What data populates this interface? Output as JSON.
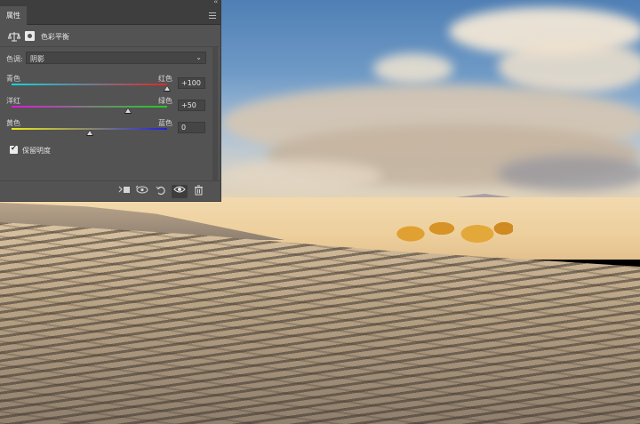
{
  "panel": {
    "tab_label": "属性",
    "collapse_glyph": "‹‹",
    "header_title": "色彩平衡",
    "tone": {
      "label": "色调:",
      "selected": "阴影"
    },
    "sliders": [
      {
        "left_label": "青色",
        "right_label": "红色",
        "value": "+100",
        "level": 1.0
      },
      {
        "left_label": "洋红",
        "right_label": "绿色",
        "value": "+50",
        "level": 0.75
      },
      {
        "left_label": "黄色",
        "right_label": "蓝色",
        "value": "0",
        "level": 0.5
      }
    ],
    "preserve_luminosity": {
      "label": "保留明度",
      "checked": true
    },
    "footer_icons": [
      "clip-to-layer-icon",
      "toggle-previous-state-icon",
      "reset-icon",
      "visibility-eye-icon",
      "trash-icon"
    ]
  }
}
